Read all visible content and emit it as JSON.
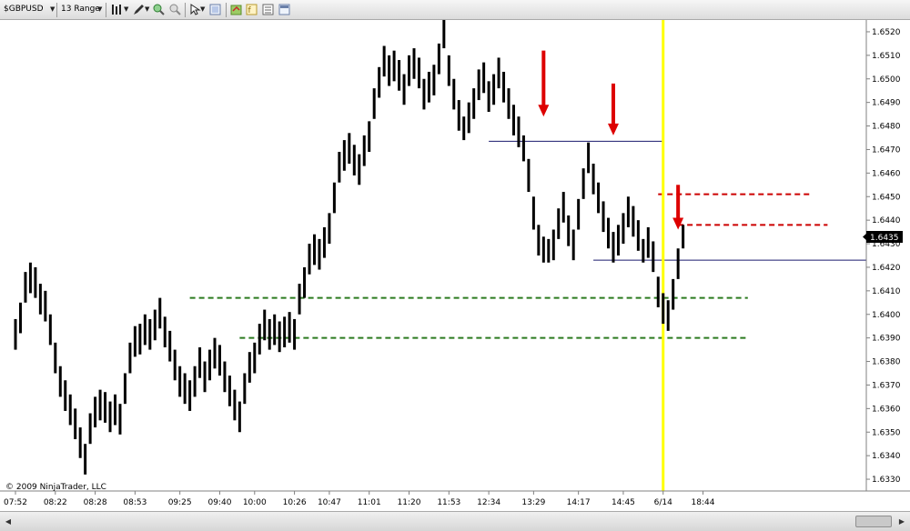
{
  "toolbar": {
    "instrument": "$GBPUSD",
    "period": "13 Range",
    "icons": [
      "bar-style-icon",
      "pencil-draw-icon",
      "zoom-in-icon",
      "zoom-out-icon",
      "cursor-icon",
      "data-box-icon",
      "properties-icon",
      "strategies-icon",
      "template-icon"
    ]
  },
  "chart_data": {
    "type": "ohlc-bar",
    "instrument": "$GBPUSD",
    "copyright": "© 2009 NinjaTrader, LLC",
    "ylim": [
      1.6325,
      1.6525
    ],
    "y_ticks": [
      "1.6520",
      "1.6510",
      "1.6500",
      "1.6490",
      "1.6480",
      "1.6470",
      "1.6460",
      "1.6450",
      "1.6440",
      "1.6430",
      "1.6420",
      "1.6410",
      "1.6400",
      "1.6390",
      "1.6380",
      "1.6370",
      "1.6360",
      "1.6350",
      "1.6340",
      "1.6330"
    ],
    "x_ticks": [
      "07:52",
      "08:22",
      "08:28",
      "08:53",
      "09:25",
      "09:40",
      "10:00",
      "10:26",
      "10:47",
      "11:01",
      "11:20",
      "11:53",
      "12:34",
      "13:29",
      "14:17",
      "14:45",
      "6/14",
      "18:44"
    ],
    "last_price": "1.6435",
    "bars": [
      {
        "h": 1.6398,
        "l": 1.6385
      },
      {
        "h": 1.6405,
        "l": 1.6392
      },
      {
        "h": 1.6418,
        "l": 1.6405
      },
      {
        "h": 1.6422,
        "l": 1.6409
      },
      {
        "h": 1.642,
        "l": 1.6407
      },
      {
        "h": 1.6413,
        "l": 1.64
      },
      {
        "h": 1.641,
        "l": 1.6397
      },
      {
        "h": 1.64,
        "l": 1.6387
      },
      {
        "h": 1.6388,
        "l": 1.6375
      },
      {
        "h": 1.6378,
        "l": 1.6365
      },
      {
        "h": 1.6372,
        "l": 1.6359
      },
      {
        "h": 1.6366,
        "l": 1.6353
      },
      {
        "h": 1.636,
        "l": 1.6347
      },
      {
        "h": 1.6352,
        "l": 1.6339
      },
      {
        "h": 1.6345,
        "l": 1.6332
      },
      {
        "h": 1.6358,
        "l": 1.6345
      },
      {
        "h": 1.6365,
        "l": 1.6352
      },
      {
        "h": 1.6368,
        "l": 1.6355
      },
      {
        "h": 1.6367,
        "l": 1.6354
      },
      {
        "h": 1.6363,
        "l": 1.635
      },
      {
        "h": 1.6366,
        "l": 1.6353
      },
      {
        "h": 1.6362,
        "l": 1.6349
      },
      {
        "h": 1.6375,
        "l": 1.6362
      },
      {
        "h": 1.6388,
        "l": 1.6375
      },
      {
        "h": 1.6395,
        "l": 1.6382
      },
      {
        "h": 1.6396,
        "l": 1.6383
      },
      {
        "h": 1.64,
        "l": 1.6387
      },
      {
        "h": 1.6398,
        "l": 1.6385
      },
      {
        "h": 1.6402,
        "l": 1.6389
      },
      {
        "h": 1.6407,
        "l": 1.6394
      },
      {
        "h": 1.6399,
        "l": 1.6386
      },
      {
        "h": 1.6393,
        "l": 1.638
      },
      {
        "h": 1.6385,
        "l": 1.6372
      },
      {
        "h": 1.6378,
        "l": 1.6365
      },
      {
        "h": 1.6375,
        "l": 1.6362
      },
      {
        "h": 1.6372,
        "l": 1.6359
      },
      {
        "h": 1.6378,
        "l": 1.6365
      },
      {
        "h": 1.6386,
        "l": 1.6373
      },
      {
        "h": 1.638,
        "l": 1.6367
      },
      {
        "h": 1.6385,
        "l": 1.6372
      },
      {
        "h": 1.639,
        "l": 1.6377
      },
      {
        "h": 1.6387,
        "l": 1.6374
      },
      {
        "h": 1.638,
        "l": 1.6367
      },
      {
        "h": 1.6374,
        "l": 1.6361
      },
      {
        "h": 1.6368,
        "l": 1.6355
      },
      {
        "h": 1.6363,
        "l": 1.635
      },
      {
        "h": 1.6375,
        "l": 1.6362
      },
      {
        "h": 1.6384,
        "l": 1.6371
      },
      {
        "h": 1.6388,
        "l": 1.6375
      },
      {
        "h": 1.6396,
        "l": 1.6383
      },
      {
        "h": 1.6402,
        "l": 1.6389
      },
      {
        "h": 1.6398,
        "l": 1.6385
      },
      {
        "h": 1.64,
        "l": 1.6387
      },
      {
        "h": 1.6397,
        "l": 1.6384
      },
      {
        "h": 1.6399,
        "l": 1.6386
      },
      {
        "h": 1.6401,
        "l": 1.6388
      },
      {
        "h": 1.6398,
        "l": 1.6385
      },
      {
        "h": 1.6413,
        "l": 1.64
      },
      {
        "h": 1.642,
        "l": 1.6407
      },
      {
        "h": 1.643,
        "l": 1.6417
      },
      {
        "h": 1.6434,
        "l": 1.6421
      },
      {
        "h": 1.6432,
        "l": 1.6419
      },
      {
        "h": 1.6437,
        "l": 1.6424
      },
      {
        "h": 1.6443,
        "l": 1.643
      },
      {
        "h": 1.6456,
        "l": 1.6443
      },
      {
        "h": 1.6469,
        "l": 1.6456
      },
      {
        "h": 1.6474,
        "l": 1.6461
      },
      {
        "h": 1.6477,
        "l": 1.6464
      },
      {
        "h": 1.6472,
        "l": 1.6459
      },
      {
        "h": 1.6468,
        "l": 1.6455
      },
      {
        "h": 1.6476,
        "l": 1.6463
      },
      {
        "h": 1.6482,
        "l": 1.6469
      },
      {
        "h": 1.6496,
        "l": 1.6483
      },
      {
        "h": 1.6505,
        "l": 1.6492
      },
      {
        "h": 1.6514,
        "l": 1.6501
      },
      {
        "h": 1.651,
        "l": 1.6497
      },
      {
        "h": 1.6512,
        "l": 1.6499
      },
      {
        "h": 1.6508,
        "l": 1.6495
      },
      {
        "h": 1.6502,
        "l": 1.6489
      },
      {
        "h": 1.651,
        "l": 1.6497
      },
      {
        "h": 1.6513,
        "l": 1.65
      },
      {
        "h": 1.6509,
        "l": 1.6496
      },
      {
        "h": 1.65,
        "l": 1.6487
      },
      {
        "h": 1.6503,
        "l": 1.649
      },
      {
        "h": 1.6506,
        "l": 1.6493
      },
      {
        "h": 1.6515,
        "l": 1.6502
      },
      {
        "h": 1.6526,
        "l": 1.6513
      },
      {
        "h": 1.651,
        "l": 1.6497
      },
      {
        "h": 1.65,
        "l": 1.6487
      },
      {
        "h": 1.6491,
        "l": 1.6478
      },
      {
        "h": 1.6484,
        "l": 1.6474
      },
      {
        "h": 1.649,
        "l": 1.6477
      },
      {
        "h": 1.6496,
        "l": 1.6483
      },
      {
        "h": 1.6504,
        "l": 1.6491
      },
      {
        "h": 1.6507,
        "l": 1.6494
      },
      {
        "h": 1.6499,
        "l": 1.6486
      },
      {
        "h": 1.6502,
        "l": 1.6489
      },
      {
        "h": 1.6509,
        "l": 1.6496
      },
      {
        "h": 1.6503,
        "l": 1.649
      },
      {
        "h": 1.6496,
        "l": 1.6483
      },
      {
        "h": 1.6489,
        "l": 1.6476
      },
      {
        "h": 1.6484,
        "l": 1.6471
      },
      {
        "h": 1.6476,
        "l": 1.6465
      },
      {
        "h": 1.6466,
        "l": 1.6452
      },
      {
        "h": 1.645,
        "l": 1.6436
      },
      {
        "h": 1.6438,
        "l": 1.6425
      },
      {
        "h": 1.6433,
        "l": 1.6422
      },
      {
        "h": 1.6432,
        "l": 1.6422
      },
      {
        "h": 1.6436,
        "l": 1.6423
      },
      {
        "h": 1.6445,
        "l": 1.6432
      },
      {
        "h": 1.6452,
        "l": 1.6439
      },
      {
        "h": 1.6442,
        "l": 1.6429
      },
      {
        "h": 1.6436,
        "l": 1.6423
      },
      {
        "h": 1.6449,
        "l": 1.6436
      },
      {
        "h": 1.6462,
        "l": 1.6449
      },
      {
        "h": 1.6473,
        "l": 1.646
      },
      {
        "h": 1.6464,
        "l": 1.6451
      },
      {
        "h": 1.6456,
        "l": 1.6443
      },
      {
        "h": 1.6448,
        "l": 1.6435
      },
      {
        "h": 1.6441,
        "l": 1.6428
      },
      {
        "h": 1.6435,
        "l": 1.6422
      },
      {
        "h": 1.6438,
        "l": 1.6425
      },
      {
        "h": 1.6443,
        "l": 1.643
      },
      {
        "h": 1.645,
        "l": 1.6437
      },
      {
        "h": 1.6446,
        "l": 1.6433
      },
      {
        "h": 1.644,
        "l": 1.6427
      },
      {
        "h": 1.6432,
        "l": 1.6422
      },
      {
        "h": 1.6437,
        "l": 1.6424
      },
      {
        "h": 1.6431,
        "l": 1.6418
      },
      {
        "h": 1.6416,
        "l": 1.6403
      },
      {
        "h": 1.6409,
        "l": 1.6396
      },
      {
        "h": 1.6406,
        "l": 1.6393
      },
      {
        "h": 1.6415,
        "l": 1.6402
      },
      {
        "h": 1.6428,
        "l": 1.6415
      },
      {
        "h": 1.6438,
        "l": 1.6428
      }
    ],
    "x_tick_bars": [
      0,
      8,
      16,
      24,
      33,
      41,
      48,
      56,
      63,
      71,
      79,
      87,
      95,
      104,
      113,
      122,
      130,
      138
    ],
    "levels": [
      {
        "name": "blue-line-upper",
        "price": 1.64735,
        "from_bar": 95,
        "to_bar": 130,
        "color": "#1a1a6e",
        "style": "solid"
      },
      {
        "name": "blue-line-lower",
        "price": 1.6423,
        "from_bar": 116,
        "to_bar": 999,
        "color": "#1a1a6e",
        "style": "solid"
      },
      {
        "name": "red-dash-upper",
        "price": 1.6451,
        "from_bar": 129,
        "to_bar": 160,
        "color": "#cc0000",
        "style": "dashed"
      },
      {
        "name": "red-dash-lower",
        "price": 1.6438,
        "from_bar": 133,
        "to_bar": 163,
        "color": "#cc0000",
        "style": "dashed"
      },
      {
        "name": "green-dash-upper",
        "price": 1.6407,
        "from_bar": 35,
        "to_bar": 147,
        "color": "#2b7a1f",
        "style": "dashed"
      },
      {
        "name": "green-dash-lower",
        "price": 1.639,
        "from_bar": 45,
        "to_bar": 147,
        "color": "#2b7a1f",
        "style": "dashed"
      }
    ],
    "vertical_line": {
      "bar": 130,
      "color": "#ffff00"
    },
    "arrows": [
      {
        "bar": 106,
        "price_top": 1.6512,
        "price_tip": 1.6484,
        "color": "#dd0000"
      },
      {
        "bar": 120,
        "price_top": 1.6498,
        "price_tip": 1.6476,
        "color": "#dd0000"
      },
      {
        "bar": 133,
        "price_top": 1.6455,
        "price_tip": 1.6436,
        "color": "#dd0000"
      }
    ],
    "grid": false
  }
}
